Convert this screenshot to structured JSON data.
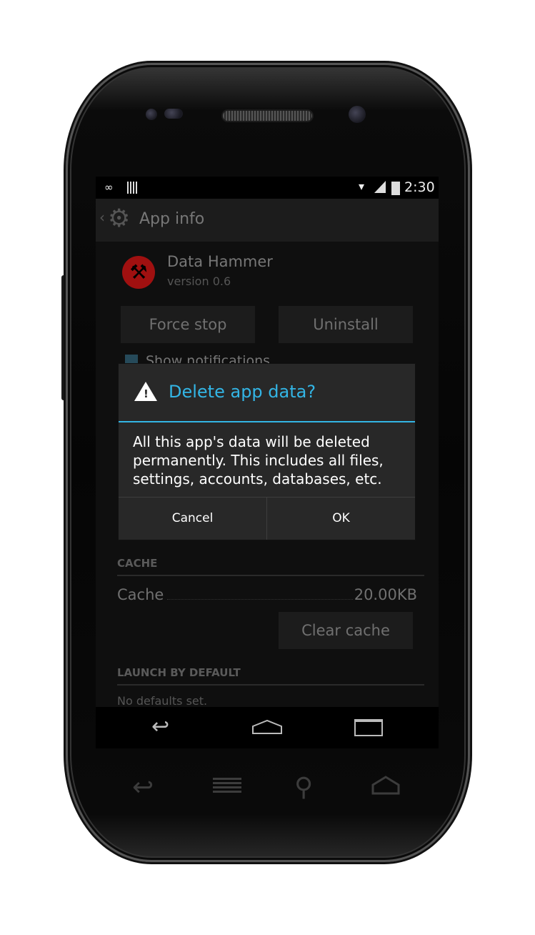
{
  "status_bar": {
    "voicemail_icon": "voicemail-icon",
    "time": "2:30"
  },
  "action_bar": {
    "icon": "settings-gear-icon",
    "title": "App info"
  },
  "app": {
    "name": "Data Hammer",
    "version": "version 0.6",
    "icon": "hammer-app-icon"
  },
  "buttons": {
    "force_stop": "Force stop",
    "uninstall": "Uninstall",
    "clear_cache": "Clear cache"
  },
  "notifications": {
    "label": "Show notifications",
    "checked": true
  },
  "sections": {
    "cache_header": "CACHE",
    "launch_header": "LAUNCH BY DEFAULT"
  },
  "cache": {
    "label": "Cache",
    "value": "20.00KB"
  },
  "launch": {
    "text": "No defaults set."
  },
  "dialog": {
    "title": "Delete app data?",
    "message": "All this app's data will be deleted permanently. This includes all files, settings, accounts, databases, etc.",
    "cancel_label": "Cancel",
    "ok_label": "OK",
    "accent_color": "#33b5e5"
  }
}
